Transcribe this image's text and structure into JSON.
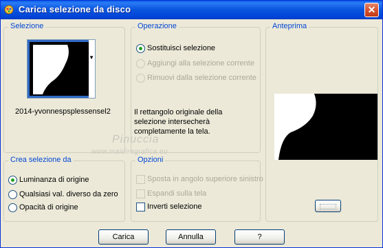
{
  "window": {
    "title": "Carica selezione da disco"
  },
  "selezione": {
    "legend": "Selezione",
    "filename": "2014-yvonnespsplessensel2"
  },
  "operazione": {
    "legend": "Operazione",
    "options": [
      {
        "label": "Sostituisci selezione",
        "checked": true,
        "enabled": true
      },
      {
        "label": "Aggiungi alla selezione corrente",
        "checked": false,
        "enabled": false
      },
      {
        "label": "Rimuovi dalla selezione corrente",
        "checked": false,
        "enabled": false
      }
    ],
    "info": "Il rettangolo originale della selezione intersecherà completamente la tela."
  },
  "anteprima": {
    "legend": "Anteprima"
  },
  "crea": {
    "legend": "Crea selezione da",
    "options": [
      {
        "label": "Luminanza di origine",
        "checked": true
      },
      {
        "label": "Qualsiasi val. diverso da zero",
        "checked": false
      },
      {
        "label": "Opacità di origine",
        "checked": false
      }
    ]
  },
  "opzioni": {
    "legend": "Opzioni",
    "items": [
      {
        "label": "Sposta in angolo superiore sinistro",
        "checked": false,
        "enabled": false
      },
      {
        "label": "Espandi sulla tela",
        "checked": false,
        "enabled": false
      },
      {
        "label": "Inverti selezione",
        "checked": false,
        "enabled": true
      }
    ]
  },
  "watermark": {
    "line1": "Pinuccia",
    "line2": "www.maidiregrafica.eu"
  },
  "buttons": {
    "carica": "Carica",
    "annulla": "Annulla",
    "help": "?"
  }
}
